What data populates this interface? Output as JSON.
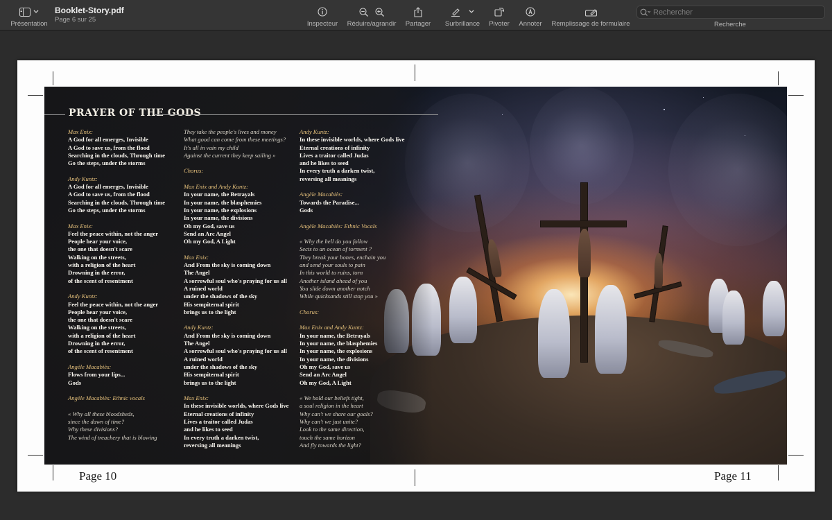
{
  "toolbar": {
    "view_label": "Présentation",
    "doc_name": "Booklet-Story.pdf",
    "page_info": "Page 6 sur 25",
    "inspector_label": "Inspecteur",
    "zoom_label": "Réduire/agrandir",
    "share_label": "Partager",
    "highlight_label": "Surbrillance",
    "rotate_label": "Pivoter",
    "annotate_label": "Annoter",
    "form_label": "Remplissage de formulaire",
    "search_placeholder": "Rechercher",
    "search_label": "Recherche"
  },
  "document": {
    "title": "PRAYER OF THE GODS",
    "left_page_number": "Page 10",
    "right_page_number": "Page 11",
    "columns": [
      [
        {
          "speaker": "Max Enix:",
          "lines": [
            "A God for all emerges, Invisible",
            "A God to save us, from the flood",
            "Searching in the clouds, Through time",
            "Go the steps, under the storms"
          ],
          "style": "sung"
        },
        {
          "speaker": "Andy Kuntz:",
          "lines": [
            "A God for all emerges, Invisible",
            "A God to save us, from the flood",
            "Searching in the clouds, Through time",
            "Go the steps, under the storms"
          ],
          "style": "sung"
        },
        {
          "speaker": "Max Enix:",
          "lines": [
            "Feel the peace within, not the anger",
            "People hear your voice,",
            "the one that doesn't scare",
            "Walking on the streets,",
            "with a religion of the heart",
            "Drowning in the error,",
            "of the scent of resentment"
          ],
          "style": "sung"
        },
        {
          "speaker": "Andy Kuntz:",
          "lines": [
            "Feel the peace within, not the anger",
            "People hear your voice,",
            "the one that doesn't scare",
            "Walking on the streets,",
            "with a religion of the heart",
            "Drowning in the error,",
            "of the scent of resentment"
          ],
          "style": "sung"
        },
        {
          "speaker": "Angèle Macabiès:",
          "lines": [
            "Flows from your lips...",
            "Gods"
          ],
          "style": "sung"
        },
        {
          "speaker": "Angèle Macabiès: Ethnic vocals",
          "lines": [],
          "style": "sung"
        },
        {
          "speaker": "",
          "lines": [
            "« Why all these bloodsheds,",
            "since the dawn of time?",
            "Why these divisions?",
            "The wind of treachery that is blowing"
          ],
          "style": "spoken"
        }
      ],
      [
        {
          "speaker": "",
          "lines": [
            "They take the people's lives and money",
            "What good can come from these meetings?",
            "It's all in vain my child",
            "Against the current they keep sailing »"
          ],
          "style": "spoken"
        },
        {
          "speaker": "Chorus:",
          "lines": [],
          "style": "sung"
        },
        {
          "speaker": "Max Enix and Andy Kuntz:",
          "lines": [
            "In your name, the Betrayals",
            "In your name, the blasphemies",
            "In your name, the explosions",
            "In your name, the divisions",
            "Oh my God, save us",
            "Send an Arc Angel",
            "Oh my God, A Light"
          ],
          "style": "sung"
        },
        {
          "speaker": "Max Enix:",
          "lines": [
            "And From the sky is coming down",
            "The Angel",
            "A sorrowful soul who's praying for us all",
            "A ruined world",
            "under the shadows of the sky",
            "His sempiternal spirit",
            "brings us to the light"
          ],
          "style": "sung"
        },
        {
          "speaker": "Andy Kuntz:",
          "lines": [
            "And From the sky is coming down",
            "The Angel",
            "A sorrowful soul who's praying for us all",
            "A ruined world",
            "under the shadows of the sky",
            "His sempiternal spirit",
            "brings us to the light"
          ],
          "style": "sung"
        },
        {
          "speaker": "Max Enix:",
          "lines": [
            "In these invisible worlds, where Gods live",
            "Eternal creations of infinity",
            "Lives a traitor called Judas",
            "and he likes to seed",
            "In every truth a darken twist,",
            "reversing all meanings"
          ],
          "style": "sung"
        }
      ],
      [
        {
          "speaker": "Andy Kuntz:",
          "lines": [
            "In these invisible worlds, where Gods live",
            "Eternal creations of infinity",
            "Lives a traitor called Judas",
            "and he likes to seed",
            "In every truth a darken twist,",
            "reversing all meanings"
          ],
          "style": "sung"
        },
        {
          "speaker": "Angèle Macabiès:",
          "lines": [
            "Towards the Paradise...",
            "Gods"
          ],
          "style": "sung"
        },
        {
          "speaker": "Angèle Macabiès: Ethnic Vocals",
          "lines": [],
          "style": "sung"
        },
        {
          "speaker": "",
          "lines": [
            "« Why the hell do you follow",
            "Sects to an ocean of torment ?",
            "They break your bones, enchain you",
            "and send your souls to pain",
            "In this world to ruins, torn",
            "Another island ahead of you",
            "You slide down another notch",
            "While quicksands still stop you »"
          ],
          "style": "spoken"
        },
        {
          "speaker": "Chorus:",
          "lines": [],
          "style": "sung"
        },
        {
          "speaker": "Max Enix and Andy Kuntz:",
          "lines": [
            "In your name, the Betrayals",
            "In your name, the blasphemies",
            "In your name, the explosions",
            "In your name, the divisions",
            "Oh my God, save us",
            "Send an Arc Angel",
            "Oh my God, A Light"
          ],
          "style": "sung"
        },
        {
          "speaker": "",
          "lines": [
            "« We hold our beliefs tight,",
            "a soul religion in the heart",
            "Why can't we share our goals?",
            "Why can't we just unite?",
            "Look to the same direction,",
            "touch the same horizon",
            "And fly towards the light?"
          ],
          "style": "spoken"
        }
      ]
    ]
  }
}
